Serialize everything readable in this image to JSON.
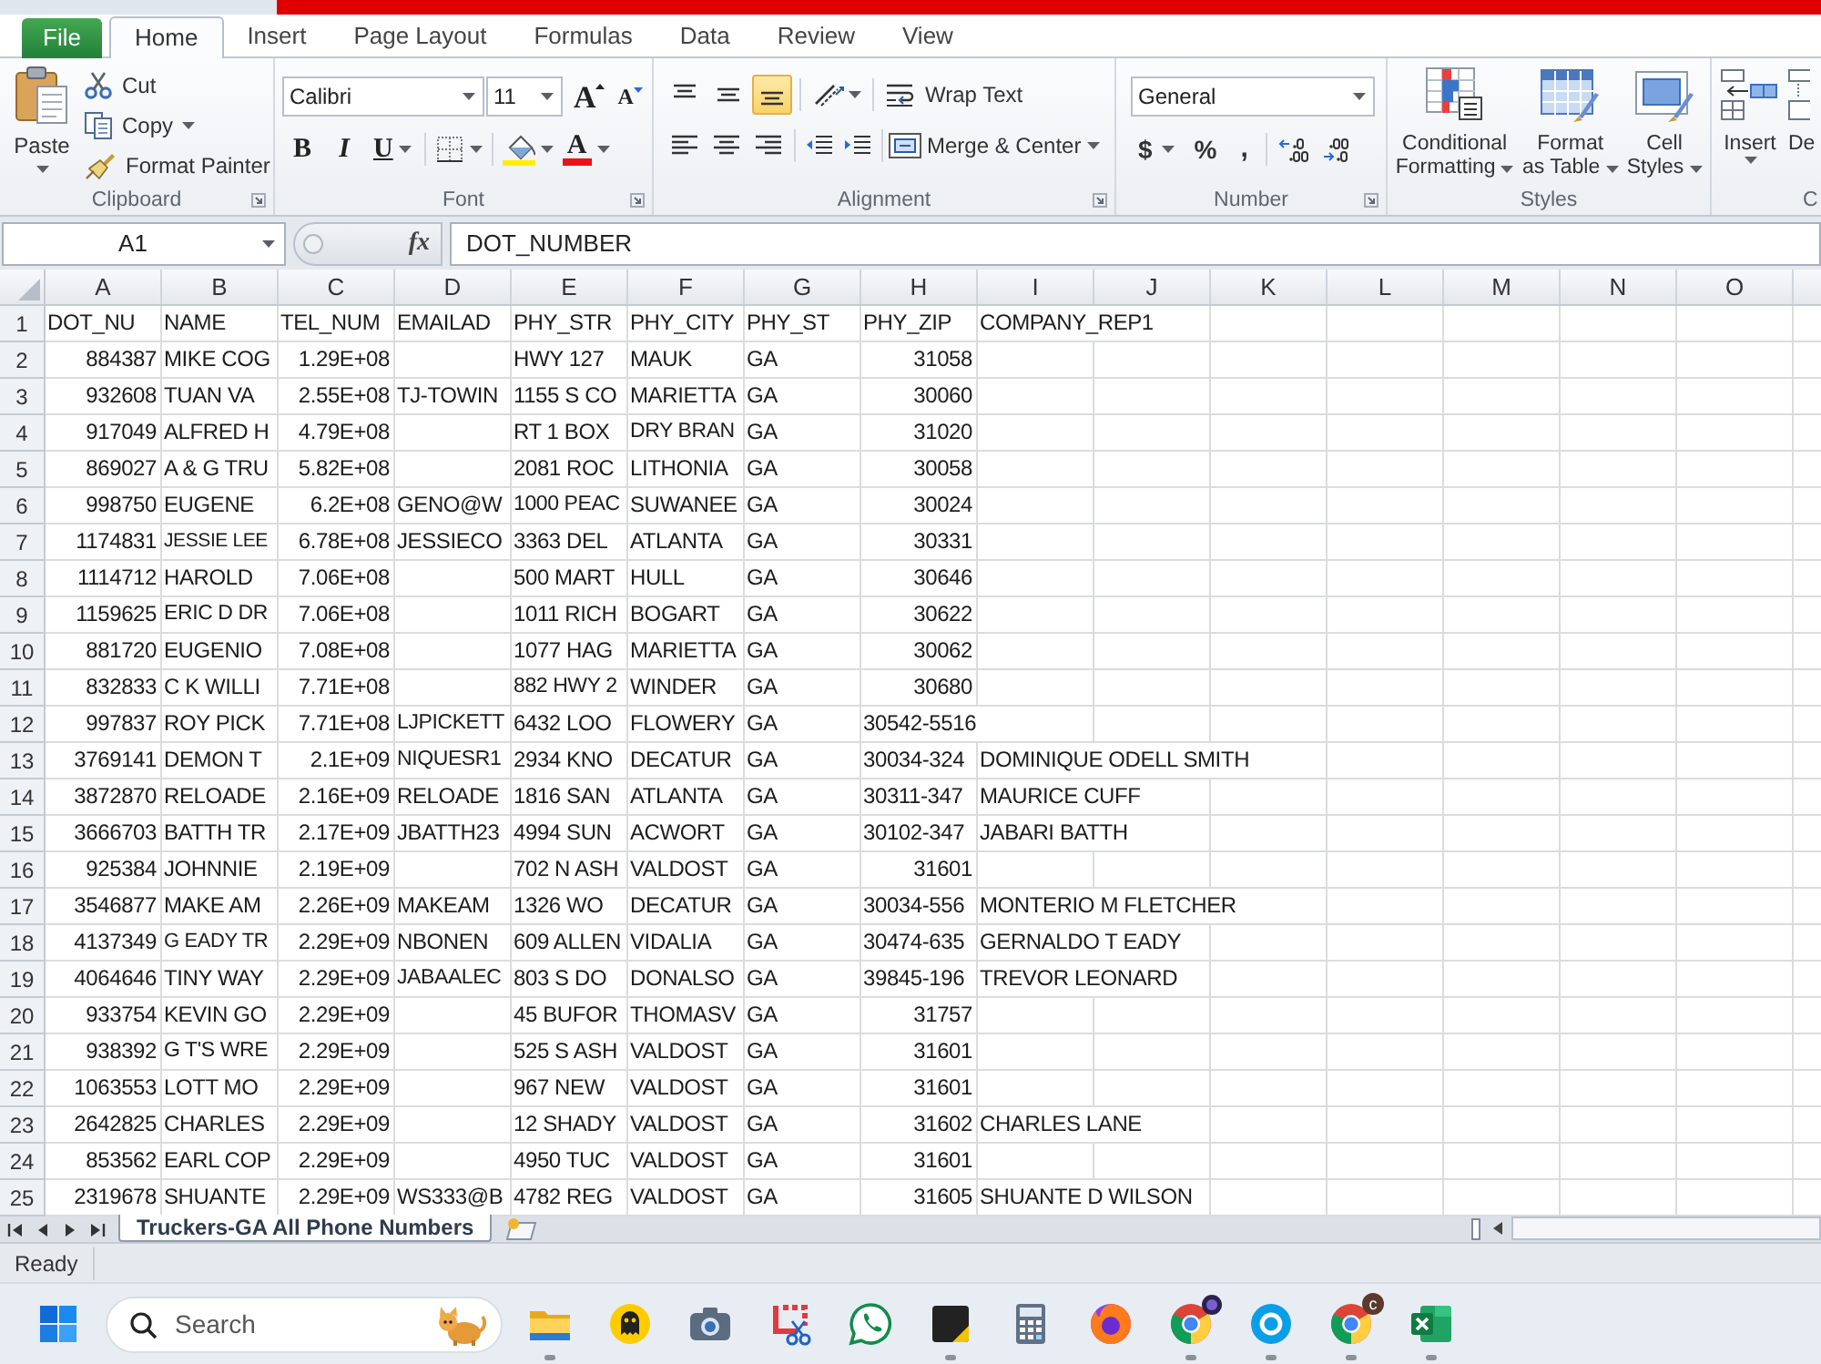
{
  "ribbon": {
    "tabs": [
      {
        "label": "File",
        "kind": "file",
        "selected": false
      },
      {
        "label": "Home",
        "kind": "tab",
        "selected": true
      },
      {
        "label": "Insert",
        "kind": "tab",
        "selected": false
      },
      {
        "label": "Page Layout",
        "kind": "tab",
        "selected": false
      },
      {
        "label": "Formulas",
        "kind": "tab",
        "selected": false
      },
      {
        "label": "Data",
        "kind": "tab",
        "selected": false
      },
      {
        "label": "Review",
        "kind": "tab",
        "selected": false
      },
      {
        "label": "View",
        "kind": "tab",
        "selected": false
      }
    ],
    "clipboard": {
      "label": "Clipboard",
      "paste": "Paste",
      "cut": "Cut",
      "copy": "Copy",
      "format_painter": "Format Painter"
    },
    "font": {
      "label": "Font",
      "font_name": "Calibri",
      "font_size": "11",
      "grow_font": "A",
      "shrink_font": "A",
      "bold": "B",
      "italic": "I",
      "underline": "U",
      "font_color": "A"
    },
    "alignment": {
      "label": "Alignment",
      "vertical_align": [
        {
          "kind": "top",
          "selected": false
        },
        {
          "kind": "middle",
          "selected": false
        },
        {
          "kind": "bottom",
          "selected": true
        }
      ],
      "wrap_text": "Wrap Text",
      "merge_center": "Merge & Center"
    },
    "number": {
      "label": "Number",
      "format": "General",
      "currency": "$",
      "percent": "%",
      "comma": ","
    },
    "styles": {
      "label": "Styles",
      "buttons": [
        {
          "kind": "conditional",
          "lines": [
            "Conditional",
            "Formatting"
          ]
        },
        {
          "kind": "table",
          "lines": [
            "Format",
            "as Table"
          ]
        },
        {
          "kind": "cell",
          "lines": [
            "Cell",
            "Styles"
          ]
        }
      ]
    },
    "cells": {
      "label": "C",
      "insert": "Insert",
      "delete": "De"
    }
  },
  "formula_bar": {
    "name_box": "A1",
    "function_label": "fx",
    "formula": "DOT_NUMBER"
  },
  "sheet": {
    "columns": [
      "A",
      "B",
      "C",
      "D",
      "E",
      "F",
      "G",
      "H",
      "I",
      "J",
      "K",
      "L",
      "M",
      "N",
      "O"
    ],
    "rows": [
      {
        "number": "1",
        "cells": [
          "DOT_NU",
          "NAME",
          "TEL_NUM",
          "EMAILAD",
          "PHY_STR",
          "PHY_CITY",
          "PHY_ST",
          "PHY_ZIP",
          "COMPANY_REP1"
        ]
      },
      {
        "number": "2",
        "cells": [
          "884387",
          "MIKE COG",
          "1.29E+08",
          null,
          "HWY 127",
          "MAUK",
          "GA",
          "31058"
        ]
      },
      {
        "number": "3",
        "cells": [
          "932608",
          "TUAN VA",
          "2.55E+08",
          "TJ-TOWIN",
          "1155 S CO",
          "MARIETTA",
          "GA",
          "30060"
        ]
      },
      {
        "number": "4",
        "cells": [
          "917049",
          "ALFRED H",
          "4.79E+08",
          null,
          "RT 1 BOX",
          "DRY BRAN",
          "GA",
          "31020"
        ]
      },
      {
        "number": "5",
        "cells": [
          "869027",
          "A & G TRU",
          "5.82E+08",
          null,
          "2081 ROC",
          "LITHONIA",
          "GA",
          "30058"
        ]
      },
      {
        "number": "6",
        "cells": [
          "998750",
          "EUGENE",
          "6.2E+08",
          "GENO@W",
          "1000 PEAC",
          "SUWANEE",
          "GA",
          "30024"
        ]
      },
      {
        "number": "7",
        "cells": [
          "1174831",
          "JESSIE LEE",
          "6.78E+08",
          "JESSIECO",
          "3363 DEL",
          "ATLANTA",
          "GA",
          "30331"
        ]
      },
      {
        "number": "8",
        "cells": [
          "1114712",
          "HAROLD",
          "7.06E+08",
          null,
          "500 MART",
          "HULL",
          "GA",
          "30646"
        ]
      },
      {
        "number": "9",
        "cells": [
          "1159625",
          "ERIC D DR",
          "7.06E+08",
          null,
          "1011 RICH",
          "BOGART",
          "GA",
          "30622"
        ]
      },
      {
        "number": "10",
        "cells": [
          "881720",
          "EUGENIO",
          "7.08E+08",
          null,
          "1077 HAG",
          "MARIETTA",
          "GA",
          "30062"
        ]
      },
      {
        "number": "11",
        "cells": [
          "832833",
          "C K WILLI",
          "7.71E+08",
          null,
          "882 HWY 2",
          "WINDER",
          "GA",
          "30680"
        ]
      },
      {
        "number": "12",
        "cells": [
          "997837",
          "ROY PICK",
          "7.71E+08",
          "LJPICKETT",
          "6432 LOO",
          "FLOWERY",
          "GA",
          "30542-5516"
        ]
      },
      {
        "number": "13",
        "cells": [
          "3769141",
          "DEMON T",
          "2.1E+09",
          "NIQUESR1",
          "2934 KNO",
          "DECATUR",
          "GA",
          "30034-324",
          "DOMINIQUE ODELL SMITH"
        ]
      },
      {
        "number": "14",
        "cells": [
          "3872870",
          "RELOADE",
          "2.16E+09",
          "RELOADE",
          "1816 SAN",
          "ATLANTA",
          "GA",
          "30311-347",
          "MAURICE CUFF"
        ]
      },
      {
        "number": "15",
        "cells": [
          "3666703",
          "BATTH TR",
          "2.17E+09",
          "JBATTH23",
          "4994 SUN",
          "ACWORT",
          "GA",
          "30102-347",
          "JABARI BATTH"
        ]
      },
      {
        "number": "16",
        "cells": [
          "925384",
          "JOHNNIE",
          "2.19E+09",
          null,
          "702 N ASH",
          "VALDOST",
          "GA",
          "31601"
        ]
      },
      {
        "number": "17",
        "cells": [
          "3546877",
          "MAKE AM",
          "2.26E+09",
          "MAKEAM",
          "1326 WO",
          "DECATUR",
          "GA",
          "30034-556",
          "MONTERIO M FLETCHER"
        ]
      },
      {
        "number": "18",
        "cells": [
          "4137349",
          "G EADY TR",
          "2.29E+09",
          "NBONEN",
          "609 ALLEN",
          "VIDALIA",
          "GA",
          "30474-635",
          "GERNALDO T EADY"
        ]
      },
      {
        "number": "19",
        "cells": [
          "4064646",
          "TINY WAY",
          "2.29E+09",
          "JABAALEC",
          "803 S DO",
          "DONALSO",
          "GA",
          "39845-196",
          "TREVOR LEONARD"
        ]
      },
      {
        "number": "20",
        "cells": [
          "933754",
          "KEVIN GO",
          "2.29E+09",
          null,
          "45 BUFOR",
          "THOMASV",
          "GA",
          "31757"
        ]
      },
      {
        "number": "21",
        "cells": [
          "938392",
          "G T'S WRE",
          "2.29E+09",
          null,
          "525 S ASH",
          "VALDOST",
          "GA",
          "31601"
        ]
      },
      {
        "number": "22",
        "cells": [
          "1063553",
          "LOTT MO",
          "2.29E+09",
          null,
          "967 NEW",
          "VALDOST",
          "GA",
          "31601"
        ]
      },
      {
        "number": "23",
        "cells": [
          "2642825",
          "CHARLES",
          "2.29E+09",
          null,
          "12 SHADY",
          "VALDOST",
          "GA",
          "31602",
          "CHARLES LANE"
        ]
      },
      {
        "number": "24",
        "cells": [
          "853562",
          "EARL COP",
          "2.29E+09",
          null,
          "4950 TUC",
          "VALDOST",
          "GA",
          "31601"
        ]
      },
      {
        "number": "25",
        "cells": [
          "2319678",
          "SHUANTE",
          "2.29E+09",
          "WS333@B",
          "4782 REG",
          "VALDOST",
          "GA",
          "31605",
          "SHUANTE D WILSON"
        ]
      }
    ]
  },
  "sheet_tabs": [
    {
      "label": "Truckers-GA All Phone Numbers",
      "selected": true
    }
  ],
  "status_bar": {
    "status": "Ready"
  },
  "taskbar": {
    "search": {
      "placeholder": "Search"
    },
    "apps": [
      {
        "kind": "folder",
        "running": true
      },
      {
        "kind": "ghost",
        "running": false
      },
      {
        "kind": "camera",
        "running": false
      },
      {
        "kind": "snip",
        "running": false
      },
      {
        "kind": "chat",
        "running": false
      },
      {
        "kind": "note",
        "running": true
      },
      {
        "kind": "calculator",
        "running": false
      },
      {
        "kind": "fox",
        "running": false
      },
      {
        "kind": "chrome",
        "running": true,
        "avatar_badge": true
      },
      {
        "kind": "skype",
        "running": true
      },
      {
        "kind": "chrome",
        "running": true,
        "badge": "c"
      },
      {
        "kind": "spreadsheet",
        "running": true
      }
    ]
  }
}
